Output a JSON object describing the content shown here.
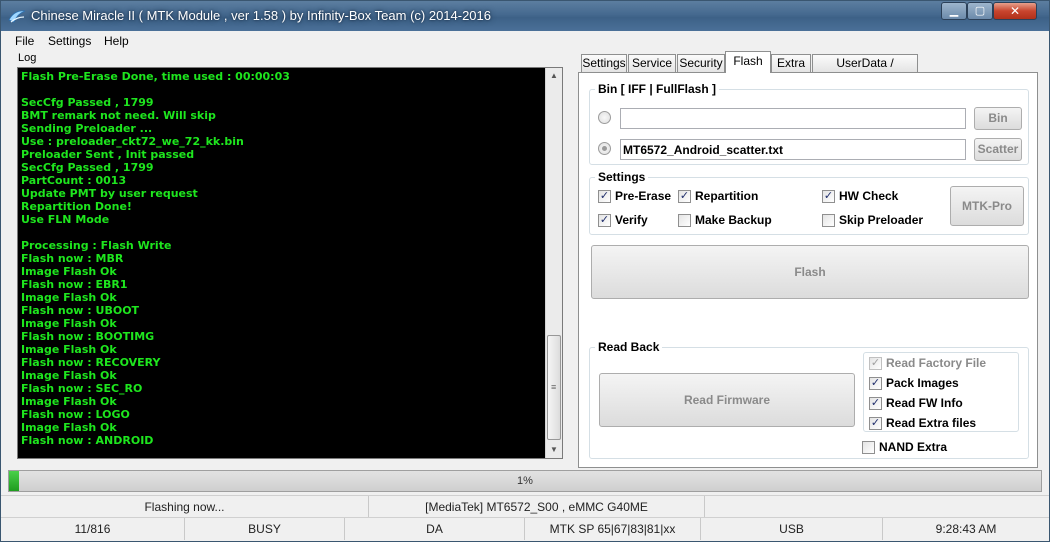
{
  "window": {
    "title": "Chinese Miracle II ( MTK Module , ver 1.58 ) by Infinity-Box Team (c) 2014-2016",
    "controls": {
      "minimize": "▁",
      "maximize": "▢",
      "close": "✕"
    }
  },
  "menu": [
    "File",
    "Settings",
    "Help"
  ],
  "log": {
    "label": "Log",
    "lines": [
      "Flash Pre-Erase Done, time used : 00:00:03",
      "",
      "SecCfg Passed , 1799",
      "BMT remark not need. Will skip",
      "Sending Preloader ...",
      "Use : preloader_ckt72_we_72_kk.bin",
      "Preloader Sent , Init passed",
      "SecCfg Passed , 1799",
      "PartCount : 0013",
      "Update PMT by user request",
      "Repartition Done!",
      "Use FLN Mode",
      "",
      "Processing : Flash Write",
      "Flash now : MBR",
      "Image Flash Ok",
      "Flash now : EBR1",
      "Image Flash Ok",
      "Flash now : UBOOT",
      "Image Flash Ok",
      "Flash now : BOOTIMG",
      "Image Flash Ok",
      "Flash now : RECOVERY",
      "Image Flash Ok",
      "Flash now : SEC_RO",
      "Image Flash Ok",
      "Flash now : LOGO",
      "Image Flash Ok",
      "Flash now : ANDROID"
    ]
  },
  "tabs": [
    "Settings",
    "Service",
    "Security",
    "Flash",
    "Extra",
    "UserData / Forensic"
  ],
  "active_tab": "Flash",
  "bin_group": {
    "title": "Bin  [ IFF | FullFlash ]",
    "iff_path": "",
    "scatter_path": "MT6572_Android_scatter.txt",
    "bin_button": "Bin",
    "scatter_button": "Scatter"
  },
  "settings_group": {
    "title": "Settings",
    "pre_erase": "Pre-Erase",
    "repartition": "Repartition",
    "hw_check": "HW Check",
    "verify": "Verify",
    "make_backup": "Make Backup",
    "skip_preloader": "Skip Preloader",
    "mtk_pro_button": "MTK-Pro"
  },
  "flash_button": "Flash",
  "readback_group": {
    "title": "Read Back",
    "read_firmware_button": "Read Firmware",
    "read_factory_file": "Read Factory File",
    "pack_images": "Pack Images",
    "read_fw_info": "Read FW Info",
    "read_extra_files": "Read Extra files",
    "nand_extra": "NAND Extra"
  },
  "progress": {
    "percent": 1,
    "text": "1%"
  },
  "status_bar_1": [
    "Flashing now...",
    "[MediaTek] MT6572_S00 , eMMC G40ME",
    ""
  ],
  "status_bar_2": [
    "11/816",
    "BUSY",
    "DA",
    "MTK SP 65|67|83|81|xx",
    "USB",
    "9:28:43 AM"
  ],
  "colors": {
    "log_text": "#1ee61e",
    "log_bg": "#000000",
    "progress_fill": "#2fae2f"
  },
  "icons": {
    "check": "✓",
    "scroll_up": "▲",
    "scroll_down": "▼",
    "grip": "≡"
  }
}
